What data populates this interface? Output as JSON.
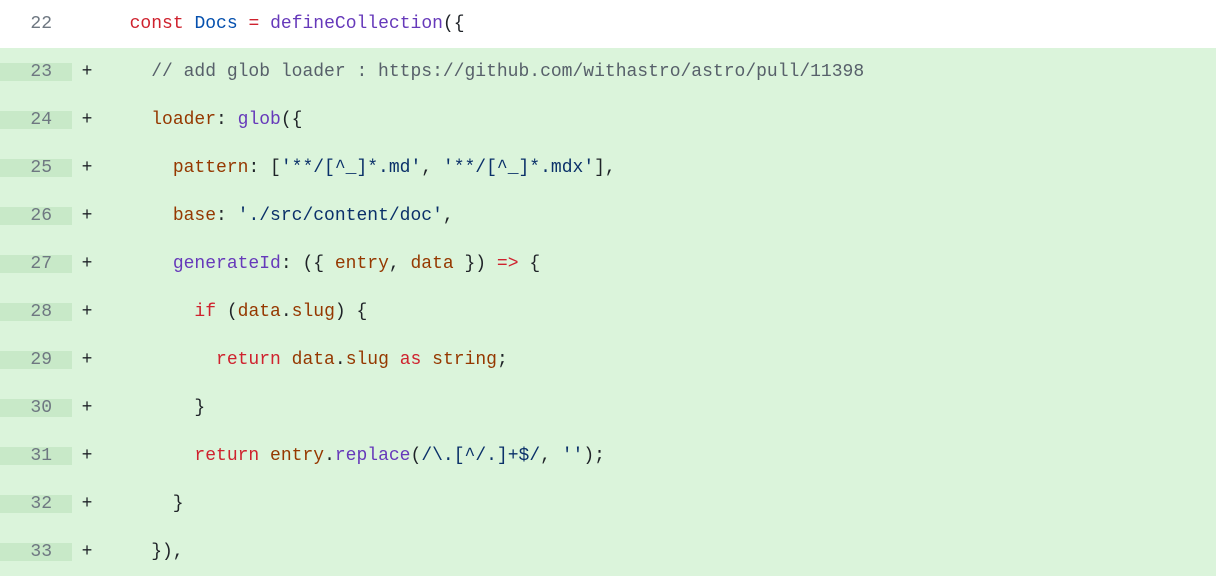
{
  "diff": {
    "lines": [
      {
        "number": "22",
        "marker": "",
        "type": "context",
        "tokens": [
          {
            "cls": "tk-plain",
            "text": "  "
          },
          {
            "cls": "tk-keyword",
            "text": "const"
          },
          {
            "cls": "tk-plain",
            "text": " "
          },
          {
            "cls": "tk-const",
            "text": "Docs"
          },
          {
            "cls": "tk-plain",
            "text": " "
          },
          {
            "cls": "tk-keyword",
            "text": "="
          },
          {
            "cls": "tk-plain",
            "text": " "
          },
          {
            "cls": "tk-entity",
            "text": "defineCollection"
          },
          {
            "cls": "tk-plain",
            "text": "({"
          }
        ]
      },
      {
        "number": "23",
        "marker": "+",
        "type": "addition",
        "tokens": [
          {
            "cls": "tk-plain",
            "text": "    "
          },
          {
            "cls": "tk-comment",
            "text": "// add glob loader : https://github.com/withastro/astro/pull/11398"
          }
        ]
      },
      {
        "number": "24",
        "marker": "+",
        "type": "addition",
        "tokens": [
          {
            "cls": "tk-plain",
            "text": "    "
          },
          {
            "cls": "tk-variable",
            "text": "loader"
          },
          {
            "cls": "tk-plain",
            "text": ": "
          },
          {
            "cls": "tk-entity",
            "text": "glob"
          },
          {
            "cls": "tk-plain",
            "text": "({"
          }
        ]
      },
      {
        "number": "25",
        "marker": "+",
        "type": "addition",
        "tokens": [
          {
            "cls": "tk-plain",
            "text": "      "
          },
          {
            "cls": "tk-variable",
            "text": "pattern"
          },
          {
            "cls": "tk-plain",
            "text": ": ["
          },
          {
            "cls": "tk-string",
            "text": "'**/[^_]*.md'"
          },
          {
            "cls": "tk-plain",
            "text": ", "
          },
          {
            "cls": "tk-string",
            "text": "'**/[^_]*.mdx'"
          },
          {
            "cls": "tk-plain",
            "text": "],"
          }
        ]
      },
      {
        "number": "26",
        "marker": "+",
        "type": "addition",
        "tokens": [
          {
            "cls": "tk-plain",
            "text": "      "
          },
          {
            "cls": "tk-variable",
            "text": "base"
          },
          {
            "cls": "tk-plain",
            "text": ": "
          },
          {
            "cls": "tk-string",
            "text": "'./src/content/doc'"
          },
          {
            "cls": "tk-plain",
            "text": ","
          }
        ]
      },
      {
        "number": "27",
        "marker": "+",
        "type": "addition",
        "tokens": [
          {
            "cls": "tk-plain",
            "text": "      "
          },
          {
            "cls": "tk-entity",
            "text": "generateId"
          },
          {
            "cls": "tk-plain",
            "text": ": ({ "
          },
          {
            "cls": "tk-variable",
            "text": "entry"
          },
          {
            "cls": "tk-plain",
            "text": ", "
          },
          {
            "cls": "tk-variable",
            "text": "data"
          },
          {
            "cls": "tk-plain",
            "text": " }) "
          },
          {
            "cls": "tk-keyword",
            "text": "=>"
          },
          {
            "cls": "tk-plain",
            "text": " {"
          }
        ]
      },
      {
        "number": "28",
        "marker": "+",
        "type": "addition",
        "tokens": [
          {
            "cls": "tk-plain",
            "text": "        "
          },
          {
            "cls": "tk-keyword",
            "text": "if"
          },
          {
            "cls": "tk-plain",
            "text": " ("
          },
          {
            "cls": "tk-variable",
            "text": "data"
          },
          {
            "cls": "tk-plain",
            "text": "."
          },
          {
            "cls": "tk-variable",
            "text": "slug"
          },
          {
            "cls": "tk-plain",
            "text": ") {"
          }
        ]
      },
      {
        "number": "29",
        "marker": "+",
        "type": "addition",
        "tokens": [
          {
            "cls": "tk-plain",
            "text": "          "
          },
          {
            "cls": "tk-keyword",
            "text": "return"
          },
          {
            "cls": "tk-plain",
            "text": " "
          },
          {
            "cls": "tk-variable",
            "text": "data"
          },
          {
            "cls": "tk-plain",
            "text": "."
          },
          {
            "cls": "tk-variable",
            "text": "slug"
          },
          {
            "cls": "tk-plain",
            "text": " "
          },
          {
            "cls": "tk-keyword",
            "text": "as"
          },
          {
            "cls": "tk-plain",
            "text": " "
          },
          {
            "cls": "tk-variable",
            "text": "string"
          },
          {
            "cls": "tk-plain",
            "text": ";"
          }
        ]
      },
      {
        "number": "30",
        "marker": "+",
        "type": "addition",
        "tokens": [
          {
            "cls": "tk-plain",
            "text": "        }"
          }
        ]
      },
      {
        "number": "31",
        "marker": "+",
        "type": "addition",
        "tokens": [
          {
            "cls": "tk-plain",
            "text": "        "
          },
          {
            "cls": "tk-keyword",
            "text": "return"
          },
          {
            "cls": "tk-plain",
            "text": " "
          },
          {
            "cls": "tk-variable",
            "text": "entry"
          },
          {
            "cls": "tk-plain",
            "text": "."
          },
          {
            "cls": "tk-entity",
            "text": "replace"
          },
          {
            "cls": "tk-plain",
            "text": "("
          },
          {
            "cls": "tk-string",
            "text": "/\\.[^/.]+$/"
          },
          {
            "cls": "tk-plain",
            "text": ", "
          },
          {
            "cls": "tk-string",
            "text": "''"
          },
          {
            "cls": "tk-plain",
            "text": ");"
          }
        ]
      },
      {
        "number": "32",
        "marker": "+",
        "type": "addition",
        "tokens": [
          {
            "cls": "tk-plain",
            "text": "      }"
          }
        ]
      },
      {
        "number": "33",
        "marker": "+",
        "type": "addition",
        "tokens": [
          {
            "cls": "tk-plain",
            "text": "    }),"
          }
        ]
      }
    ]
  }
}
